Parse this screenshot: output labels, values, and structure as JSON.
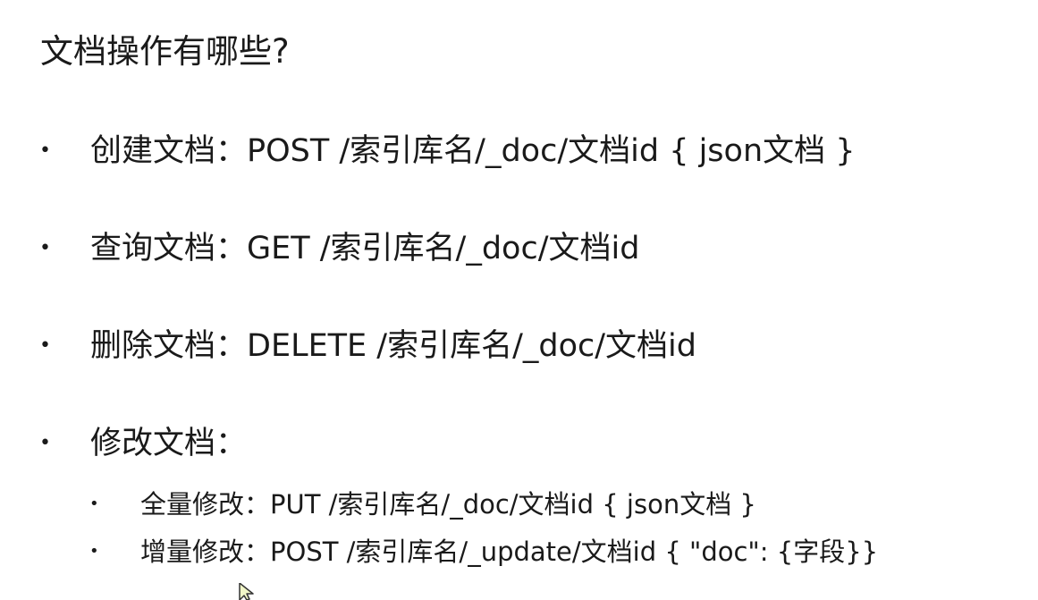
{
  "title": "文档操作有哪些?",
  "bullet_symbol": "•",
  "items": [
    {
      "text": "创建文档：POST /索引库名/_doc/文档id  { json文档 }"
    },
    {
      "text": "查询文档：GET /索引库名/_doc/文档id"
    },
    {
      "text": "删除文档：DELETE /索引库名/_doc/文档id"
    },
    {
      "text": "修改文档："
    }
  ],
  "sub_items": [
    {
      "text": "全量修改：PUT /索引库名/_doc/文档id { json文档 }"
    },
    {
      "text": "增量修改：POST /索引库名/_update/文档id { \"doc\": {字段}}"
    }
  ],
  "cursor_icon": "mouse-pointer-icon",
  "colors": {
    "text": "#1a1a1a",
    "background": "#ffffff",
    "cursor_fill": "#f2f7c8"
  }
}
